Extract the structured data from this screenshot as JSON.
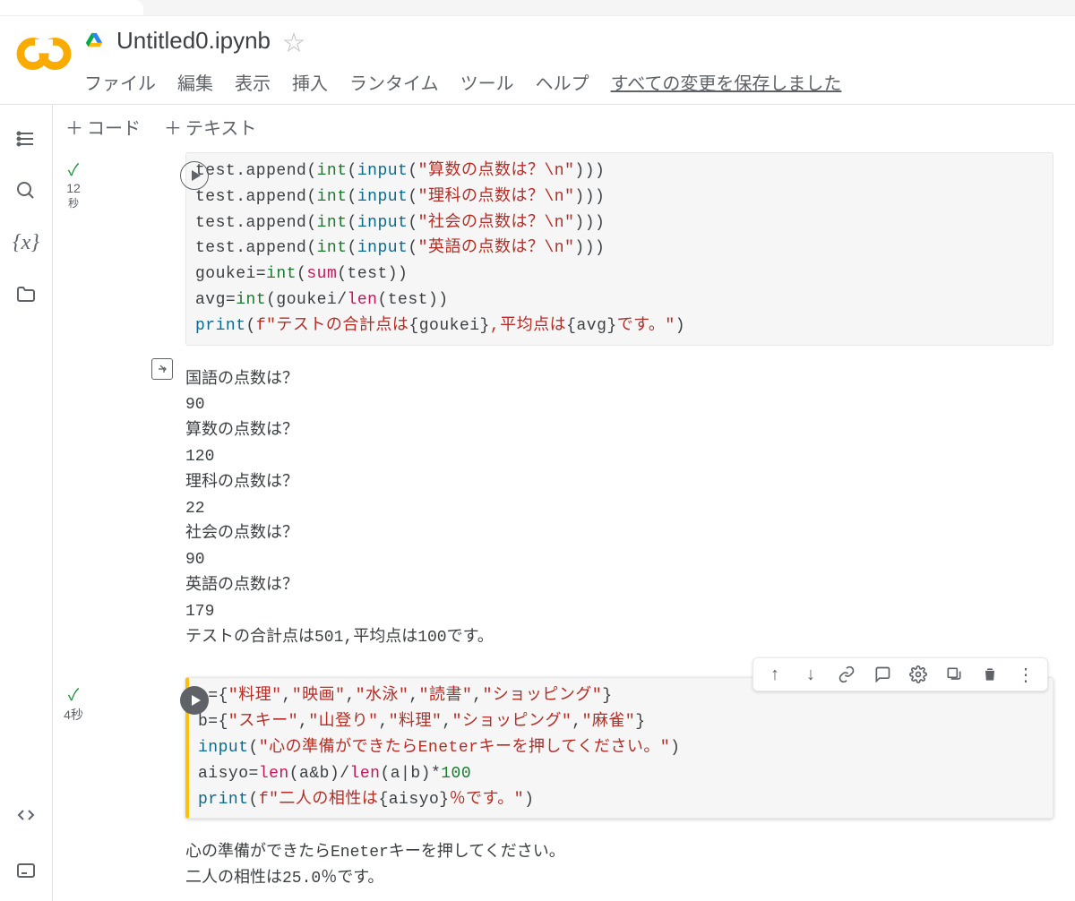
{
  "header": {
    "title": "Untitled0.ipynb",
    "star_tooltip": "スターを付ける"
  },
  "menu": {
    "file": "ファイル",
    "edit": "編集",
    "view": "表示",
    "insert": "挿入",
    "runtime": "ランタイム",
    "tools": "ツール",
    "help": "ヘルプ",
    "save_status": "すべての変更を保存しました"
  },
  "toolbar": {
    "code": "コード",
    "text": "テキスト"
  },
  "cell1": {
    "status": "12",
    "status_unit": "秒",
    "code_html": "test.append(<span class='s-int'>int</span>(<span class='s-input'>input</span>(<span class='s-str'>&quot;算数の点数は？\\n&quot;</span>)))\ntest.append(<span class='s-int'>int</span>(<span class='s-input'>input</span>(<span class='s-str'>&quot;理科の点数は？\\n&quot;</span>)))\ntest.append(<span class='s-int'>int</span>(<span class='s-input'>input</span>(<span class='s-str'>&quot;社会の点数は？\\n&quot;</span>)))\ntest.append(<span class='s-int'>int</span>(<span class='s-input'>input</span>(<span class='s-str'>&quot;英語の点数は？\\n&quot;</span>)))\ngoukei=<span class='s-int'>int</span>(<span class='s-sum'>sum</span>(test))\navg=<span class='s-int'>int</span>(goukei/<span class='s-len'>len</span>(test))\n<span class='s-print'>print</span>(<span class='s-str'>f&quot;テストの合計点は</span>{goukei}<span class='s-str'>,平均点は</span>{avg}<span class='s-str'>です。&quot;</span>)",
    "output": "国語の点数は？\n90\n算数の点数は？\n120\n理科の点数は？\n22\n社会の点数は？\n90\n英語の点数は？\n179\nテストの合計点は501,平均点は100です。"
  },
  "cell2": {
    "status": "4秒",
    "code_html": "a={<span class='s-str'>&quot;料理&quot;</span>,<span class='s-str'>&quot;映画&quot;</span>,<span class='s-str'>&quot;水泳&quot;</span>,<span class='s-str'>&quot;読書&quot;</span>,<span class='s-str'>&quot;ショッピング&quot;</span>}\nb={<span class='s-str'>&quot;スキー&quot;</span>,<span class='s-str'>&quot;山登り&quot;</span>,<span class='s-str'>&quot;料理&quot;</span>,<span class='s-str'>&quot;ショッピング&quot;</span>,<span class='s-str'>&quot;麻雀&quot;</span>}\n<span class='s-input'>input</span>(<span class='s-str'>&quot;心の準備ができたらEneterキーを押してください。&quot;</span>)\naisyo=<span class='s-len'>len</span>(a&amp;b)/<span class='s-len'>len</span>(a|b)*<span class='s-int'>100</span>\n<span class='s-print'>print</span>(<span class='s-str'>f&quot;二人の相性は</span>{aisyo}<span class='s-str'>％です。&quot;</span>)",
    "output": "心の準備ができたらEneterキーを押してください。\n二人の相性は25.0％です。"
  },
  "icons": {
    "toc": "table-of-contents-icon",
    "search": "search-icon",
    "vars": "variables-icon",
    "files": "files-icon",
    "snippets": "code-snippets-icon",
    "terminal": "terminal-icon"
  },
  "cell_toolbar": {
    "up": "↑",
    "down": "↓",
    "link": "",
    "comment": "",
    "settings": "",
    "mirror": "",
    "delete": "",
    "more": "⋮"
  }
}
